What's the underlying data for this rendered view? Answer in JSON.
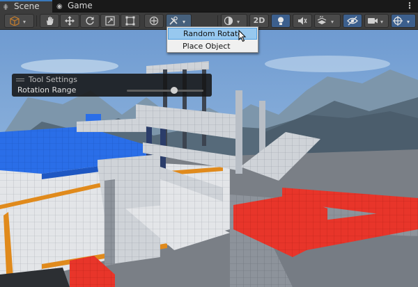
{
  "tabs": [
    {
      "label": "Scene",
      "icon": "grid-icon",
      "active": true
    },
    {
      "label": "Game",
      "icon": "gamepad-icon",
      "active": false
    }
  ],
  "toolbar": {
    "two_d_label": "2D",
    "tools": [
      "cube-icon",
      "hand-icon",
      "move-icon",
      "rotate-icon",
      "scale-icon",
      "rect-icon",
      "transform-icon",
      "custom-tool-icon"
    ],
    "view_options": [
      "shading-icon",
      "2d-toggle",
      "light-icon",
      "audio-icon",
      "effects-icon",
      "visibility-icon",
      "camera-icon",
      "gizmos-icon"
    ]
  },
  "tool_settings": {
    "title": "Tool Settings",
    "field_label": "Rotation Range",
    "slider_value": 0.62
  },
  "dropdown": {
    "items": [
      {
        "label": "Random Rotate",
        "highlighted": true
      },
      {
        "label": "Place Object",
        "highlighted": false
      }
    ]
  },
  "colors": {
    "accent": "#3a79bb",
    "toolbar_bg": "#3c3c3c",
    "menu_highlight": "#97c8ef",
    "blue_block": "#2a6ee8",
    "red_block": "#e8352a",
    "orange_trim": "#e08a1c"
  }
}
